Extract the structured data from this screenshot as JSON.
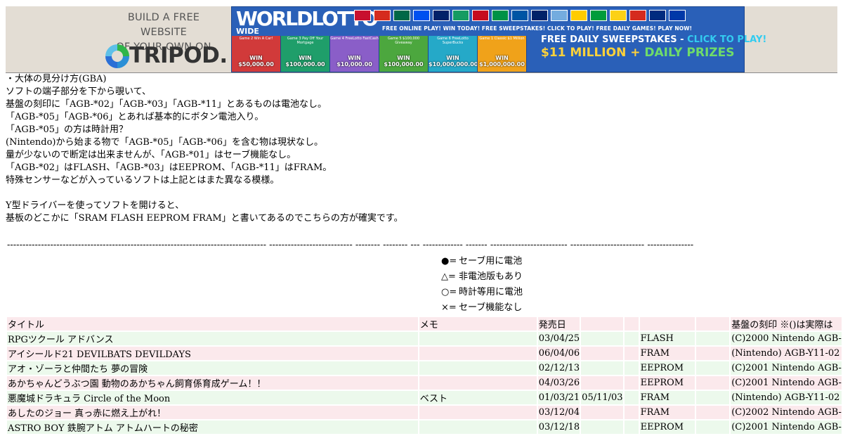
{
  "banner": {
    "tripod_tagline_1": "BUILD A FREE WEBSITE",
    "tripod_tagline_2": "OF YOUR OWN ON",
    "tripod_logo": "TRIPOD.",
    "wwl_logo_1": "WORLDLOTTO",
    "wwl_logo_2": "WIDE",
    "wwl_taglines": "FREE ONLINE PLAY!   WIN TODAY!   FREE SWEEPSTAKES!   CLICK TO PLAY!   FREE DAILY GAMES!   PLAY NOW!",
    "flag_colors": [
      "#c8102e",
      "#d52b1e",
      "#006847",
      "#0050f0",
      "#012169",
      "#169b62",
      "#c60b1e",
      "#009246",
      "#0055a4",
      "#012169",
      "#74acdf",
      "#ffcc00",
      "#009c3b",
      "#fcd116",
      "#d52b1e",
      "#002b7f",
      "#0038a8"
    ],
    "cards": [
      {
        "caption": "Game 2 Win A Car!",
        "prize": "$50,000.00",
        "color": "#d13a3a"
      },
      {
        "caption": "Game 3 Pay Off Your Mortgage",
        "prize": "$100,000.00",
        "color": "#1f9e6a"
      },
      {
        "caption": "Game 4 FreeLotto FastCash",
        "prize": "$10,000.00",
        "color": "#8a5ec8"
      },
      {
        "caption": "Game 5 $100,000 Giveaway",
        "prize": "$100,000.00",
        "color": "#4ca73e"
      },
      {
        "caption": "Game 6 FreeLotto SuperBucks",
        "prize": "$10,000,000.00",
        "color": "#25a9c8"
      },
      {
        "caption": "Game 1 Classic $1 Million",
        "prize": "$1,000,000.00",
        "color": "#f0a21a"
      }
    ],
    "promo_line1_a": "FREE DAILY SWEEPSTAKES - ",
    "promo_line1_b": "CLICK TO PLAY!",
    "promo_line2_a": "$11 MILLION + ",
    "promo_line2_b": "DAILY PRIZES"
  },
  "notes": [
    "・大体の見分け方(GBA)",
    "ソフトの端子部分を下から覗いて、",
    "基盤の刻印に「AGB-*02」「AGB-*03」「AGB-*11」とあるものは電池なし。",
    "「AGB-*05」「AGB-*06」とあれば基本的にボタン電池入り。",
    "「AGB-*05」の方は時計用？",
    "(Nintendo)から始まる物で「AGB-*05」「AGB-*06」を含む物は現状なし。",
    "量が少ないので断定は出来ませんが、「AGB-*01」はセーブ機能なし。",
    "「AGB-*02」はFLASH、「AGB-*03」はEEPROM、「AGB-*11」はFRAM。",
    "特殊センサーなどが入っているソフトは上記とはまた異なる模様。",
    "",
    "Y型ドライバーを使ってソフトを開けると、",
    "基板のどこかに「SRAM FLASH EEPROM FRAM」と書いてあるのでこちらの方が確実です。"
  ],
  "dashes": "------------------------------------------------------------------------------------ --------------------------- -------- -------- ---   -------------         -------  ------------------------- ------------------------ ---------------",
  "legend": [
    {
      "symbol": "●=",
      "text": "セーブ用に電池"
    },
    {
      "symbol": "△=",
      "text": "非電池版もあり"
    },
    {
      "symbol": "○=",
      "text": "時計等用に電池"
    },
    {
      "symbol": "×=",
      "text": "セーブ機能なし"
    }
  ],
  "table": {
    "headers": [
      "タイトル",
      "メモ",
      "発売日",
      "",
      "",
      "",
      "基盤の刻印 ※()は実際は"
    ],
    "rows": [
      {
        "title": "RPGツクール アドバンス",
        "memo": "",
        "date": "03/04/25",
        "date2": "",
        "mark": "",
        "save": "FLASH",
        "board": "(C)2000 Nintendo AGB-"
      },
      {
        "title": "アイシールド21 DEVILBATS DEVILDAYS",
        "memo": "",
        "date": "06/04/06",
        "date2": "",
        "mark": "",
        "save": "FRAM",
        "board": "(Nintendo) AGB-Y11-02"
      },
      {
        "title": "アオ・ゾーラと仲間たち 夢の冒険",
        "memo": "",
        "date": "02/12/13",
        "date2": "",
        "mark": "",
        "save": "EEPROM",
        "board": "(C)2001 Nintendo AGB-"
      },
      {
        "title": "あかちゃんどうぶつ園 動物のあかちゃん飼育係育成ゲーム！！",
        "memo": "",
        "date": "04/03/26",
        "date2": "",
        "mark": "",
        "save": "EEPROM",
        "board": "(C)2001 Nintendo AGB-"
      },
      {
        "title": "悪魔城ドラキュラ Circle of the Moon",
        "memo": "ベスト",
        "date": "01/03/21",
        "date2": "05/11/03",
        "mark": "",
        "save": "FRAM",
        "board": "(Nintendo) AGB-Y11-02"
      },
      {
        "title": "あしたのジョー 真っ赤に燃え上がれ！",
        "memo": "",
        "date": "03/12/04",
        "date2": "",
        "mark": "",
        "save": "FRAM",
        "board": "(C)2002 Nintendo AGB-"
      },
      {
        "title": "ASTRO BOY 鉄腕アトム アトムハートの秘密",
        "memo": "",
        "date": "03/12/18",
        "date2": "",
        "mark": "",
        "save": "EEPROM",
        "board": "(C)2001 Nintendo AGB-"
      }
    ]
  }
}
